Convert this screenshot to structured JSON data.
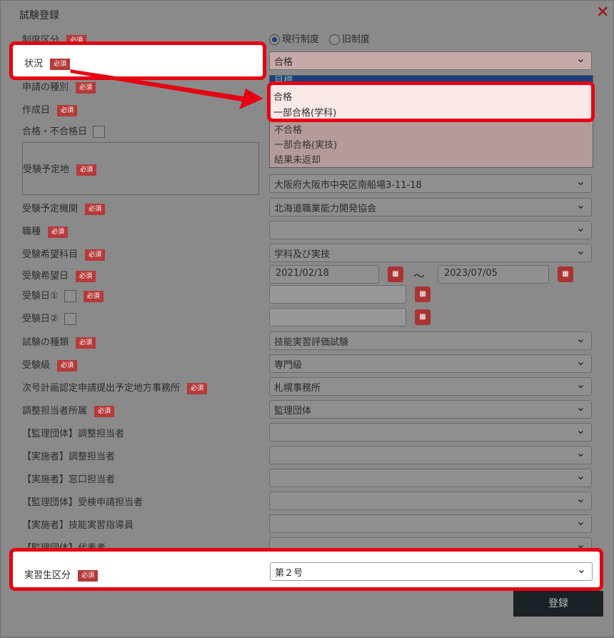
{
  "dialog": {
    "title": "試験登録",
    "close_label": "✕",
    "required": "必須"
  },
  "seido": {
    "label": "制度区分",
    "options": [
      "現行制度",
      "旧制度"
    ]
  },
  "status": {
    "label": "状況",
    "value": "合格",
    "options": [
      "目標",
      "合格",
      "一部合格(学科)",
      "不合格",
      "一部合格(実技)",
      "結果未返却"
    ]
  },
  "fields": {
    "shinsei": "申請の種別",
    "sakusei": "作成日",
    "goukaku_date": "合格・不合格日",
    "yotei_chi": "受験予定地",
    "yotei_chi_value": "大阪府大阪市中央区南船場3-11-18",
    "yotei_kikan": "受験予定機関",
    "yotei_kikan_value": "北海道職業能力開発協会",
    "shokushu": "職種",
    "kibou_kamoku": "受験希望科目",
    "kibou_kamoku_value": "学科及び実技",
    "kibou_bi": "受験希望日",
    "kibou_from": "2021/02/18",
    "kibou_sep": "～",
    "kibou_to": "2023/07/05",
    "jukenbi1": "受験日①",
    "jukenbi2": "受験日②",
    "shiken_shurui": "試験の種類",
    "shiken_shurui_value": "技能実習評価試験",
    "kyuu": "受験級",
    "kyuu_value": "専門級",
    "jimusho": "次号計画認定申請提出予定地方事務所",
    "jimusho_value": "札幌事務所",
    "chousei_shozoku": "調整担当者所属",
    "chousei_shozoku_value": "監理団体",
    "kanri_chousei": "【監理団体】調整担当者",
    "jisshi_chousei": "【実施者】調整担当者",
    "jisshi_madoguchi": "【実施者】窓口担当者",
    "kanri_jukensha": "【監理団体】受検申請担当者",
    "jisshi_shidou": "【実施者】技能実習指導員",
    "kanri_daihyou": "【監理団体】代表者",
    "kubun": "実習生区分",
    "kubun_value": "第２号"
  },
  "buttons": {
    "register": "登録"
  }
}
